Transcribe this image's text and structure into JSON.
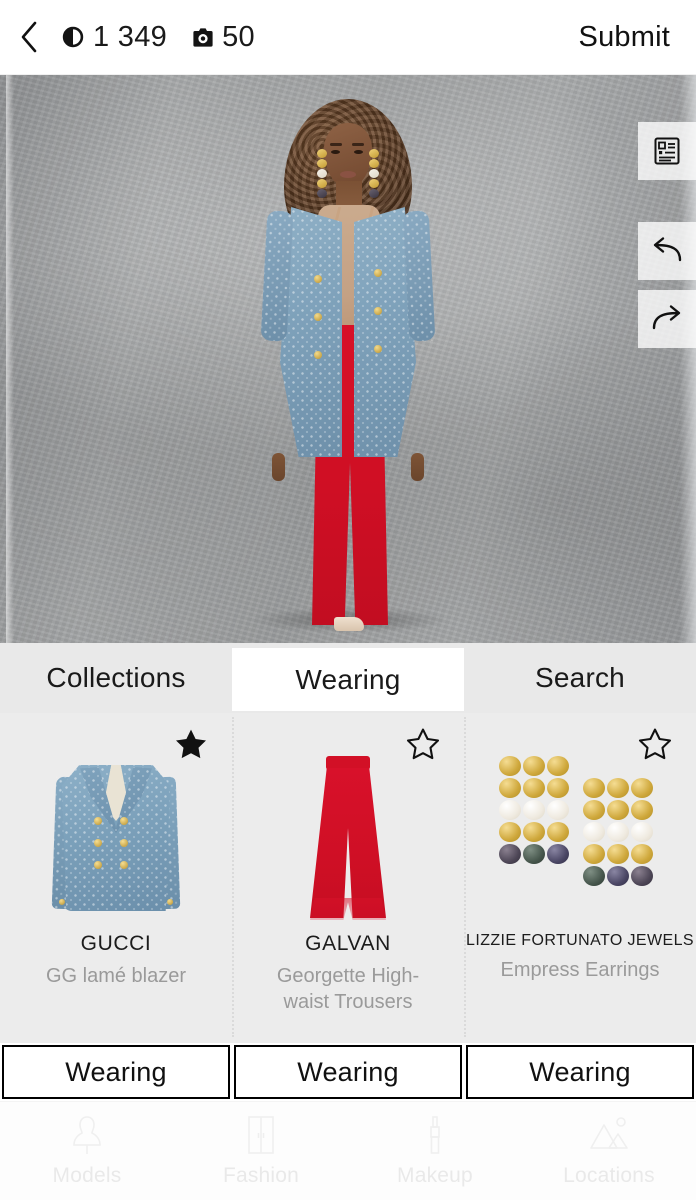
{
  "header": {
    "back_icon": "chevron-left-icon",
    "coin_icon": "coin-icon",
    "coin_value": "1 349",
    "gem_icon": "camera-token-icon",
    "gem_value": "50",
    "submit_label": "Submit"
  },
  "canvas": {
    "tools": [
      {
        "name": "details-list-icon",
        "label": "details"
      },
      {
        "name": "undo-arrow-icon",
        "label": "undo"
      },
      {
        "name": "redo-arrow-icon",
        "label": "redo"
      }
    ],
    "scene": {
      "backdrop": "grey concrete studio backdrop",
      "model": "female model with curly auburn hair",
      "outfit": [
        "blue GG lamé blazer",
        "red wide-leg trousers",
        "gold pearl drop earrings",
        "nude heels"
      ]
    }
  },
  "tabs": [
    {
      "label": "Collections",
      "active": false
    },
    {
      "label": "Wearing",
      "active": true
    },
    {
      "label": "Search",
      "active": false
    }
  ],
  "products": [
    {
      "brand": "GUCCI",
      "name": "GG lamé blazer",
      "favorited": true,
      "star_icon": "star-filled-icon",
      "action_label": "Wearing"
    },
    {
      "brand": "GALVAN",
      "name": "Georgette High-waist Trousers",
      "favorited": false,
      "star_icon": "star-outline-icon",
      "action_label": "Wearing"
    },
    {
      "brand": "LIZZIE FORTUNATO JEWELS",
      "name": "Empress Earrings",
      "favorited": false,
      "star_icon": "star-outline-icon",
      "action_label": "Wearing"
    }
  ],
  "bottom_nav": [
    {
      "label": "Models",
      "icon": "mannequin-icon"
    },
    {
      "label": "Fashion",
      "icon": "wardrobe-icon"
    },
    {
      "label": "Makeup",
      "icon": "lipstick-icon"
    },
    {
      "label": "Locations",
      "icon": "landscape-icon"
    }
  ],
  "colors": {
    "accent_red": "#d4102a",
    "blazer_blue": "#7ba0ba",
    "gold": "#cfa83c",
    "panel_bg": "#ececec",
    "tab_bg": "#e9e9e9"
  }
}
